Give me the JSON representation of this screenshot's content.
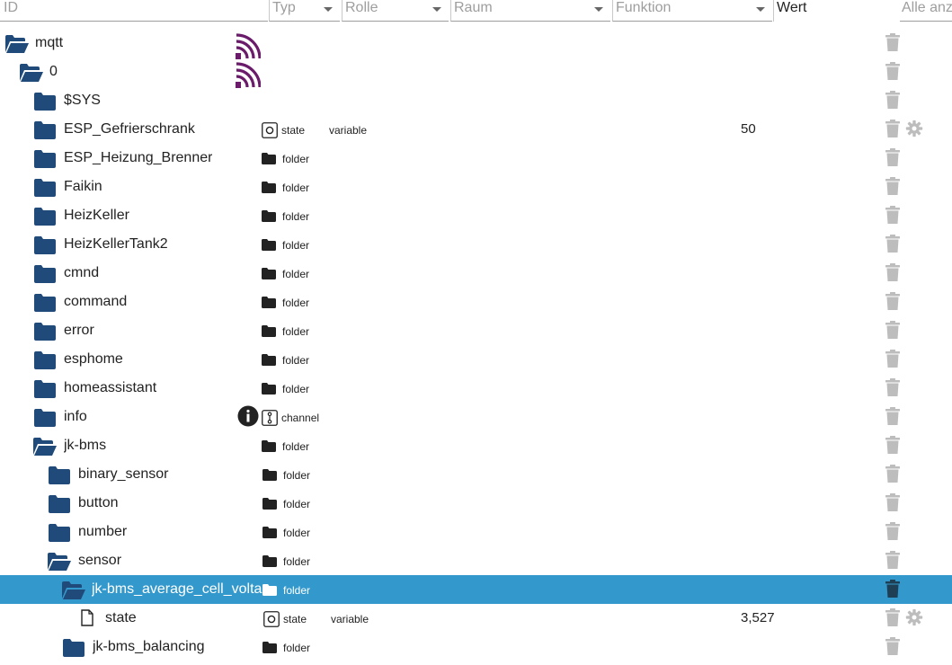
{
  "header": {
    "id_placeholder": "ID",
    "typ_label": "Typ",
    "rolle_label": "Rolle",
    "raum_label": "Raum",
    "funktion_label": "Funktion",
    "wert_label": "Wert",
    "alle_label": "Alle anz"
  },
  "rows": [
    {
      "name": "mqtt",
      "type": "",
      "role": "",
      "value": ""
    },
    {
      "name": "0",
      "type": "",
      "role": "",
      "value": ""
    },
    {
      "name": "$SYS",
      "type": "",
      "role": "",
      "value": ""
    },
    {
      "name": "ESP_Gefrierschrank",
      "type": "state",
      "role": "variable",
      "value": "50"
    },
    {
      "name": "ESP_Heizung_Brenner",
      "type": "folder",
      "role": "",
      "value": ""
    },
    {
      "name": "Faikin",
      "type": "folder",
      "role": "",
      "value": ""
    },
    {
      "name": "HeizKeller",
      "type": "folder",
      "role": "",
      "value": ""
    },
    {
      "name": "HeizKellerTank2",
      "type": "folder",
      "role": "",
      "value": ""
    },
    {
      "name": "cmnd",
      "type": "folder",
      "role": "",
      "value": ""
    },
    {
      "name": "command",
      "type": "folder",
      "role": "",
      "value": ""
    },
    {
      "name": "error",
      "type": "folder",
      "role": "",
      "value": ""
    },
    {
      "name": "esphome",
      "type": "folder",
      "role": "",
      "value": ""
    },
    {
      "name": "homeassistant",
      "type": "folder",
      "role": "",
      "value": ""
    },
    {
      "name": "info",
      "type": "channel",
      "role": "",
      "value": ""
    },
    {
      "name": "jk-bms",
      "type": "folder",
      "role": "",
      "value": ""
    },
    {
      "name": "binary_sensor",
      "type": "folder",
      "role": "",
      "value": ""
    },
    {
      "name": "button",
      "type": "folder",
      "role": "",
      "value": ""
    },
    {
      "name": "number",
      "type": "folder",
      "role": "",
      "value": ""
    },
    {
      "name": "sensor",
      "type": "folder",
      "role": "",
      "value": ""
    },
    {
      "name": "jk-bms_average_cell_voltag",
      "type": "folder",
      "role": "",
      "value": ""
    },
    {
      "name": "state",
      "type": "state",
      "role": "variable",
      "value": "3,527"
    },
    {
      "name": "jk-bms_balancing",
      "type": "folder",
      "role": "",
      "value": ""
    }
  ],
  "colors": {
    "folder": "#1f4a7a",
    "selected_bg": "#3399cc",
    "logo": "#6a1b6a",
    "trash": "#bdbdbd"
  }
}
